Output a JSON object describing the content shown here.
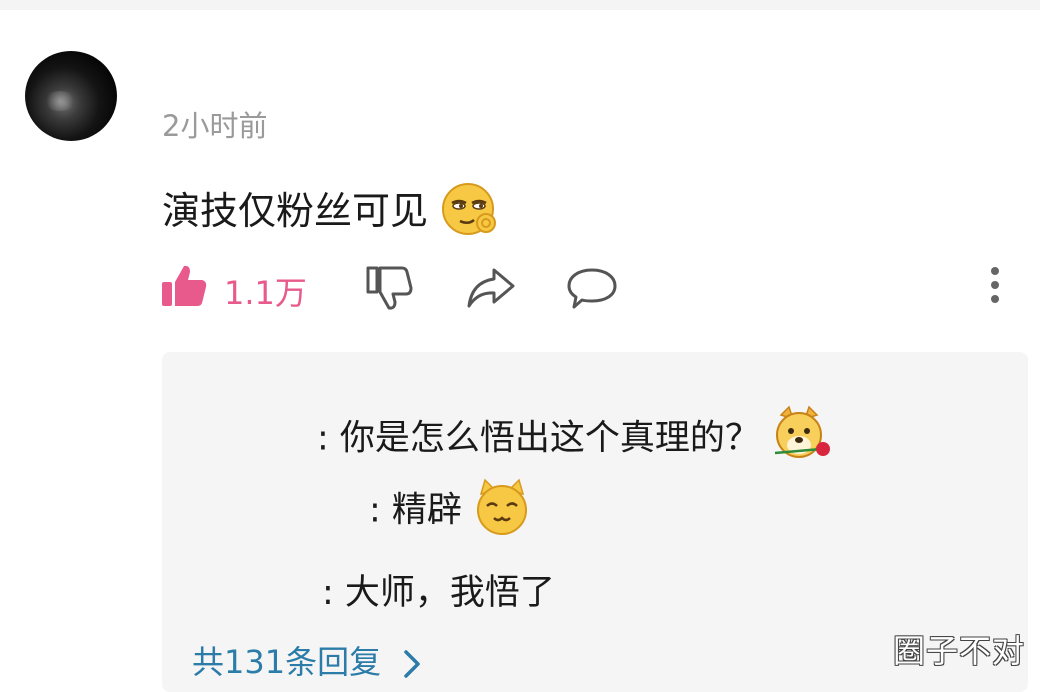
{
  "comment": {
    "time": "2小时前",
    "text": "演技仅粉丝可见",
    "like_count": "1.1万"
  },
  "replies": [
    {
      "text": ": 你是怎么悟出这个真理的？"
    },
    {
      "text": ": 精辟"
    },
    {
      "text": ": 大师，我悟了"
    }
  ],
  "more_replies": "共131条回复",
  "watermark": "圈子不对",
  "colors": {
    "like": "#e85a8c",
    "link": "#2b7ca8",
    "reply_bg": "#f5f5f5"
  }
}
